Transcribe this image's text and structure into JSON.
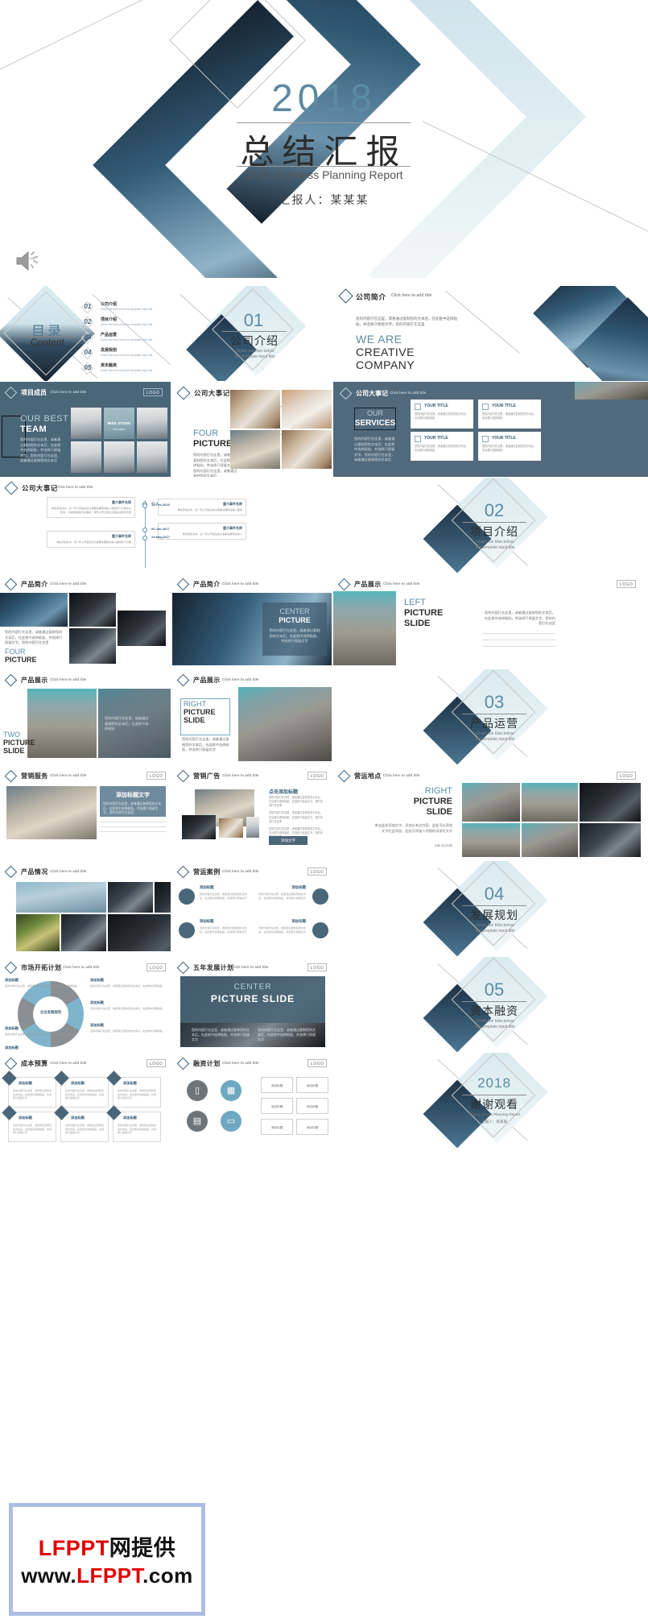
{
  "document": {
    "type": "powerpoint-template-preview",
    "watermark": {
      "line1_red": "LFPPT",
      "line1_black": "网提供",
      "line2_prefix": "www.",
      "line2_red": "LFPPT",
      "line2_suffix": ".com"
    },
    "accent_color": "#4a6679",
    "accent_light": "#bcd6de",
    "title_blue": "#5b8ba3"
  },
  "cover": {
    "year": "2018",
    "title_cn": "总结汇报",
    "subtitle_en": "2018 Business Planning Report",
    "presenter": "汇报人：某某某",
    "audio_icon": "speaker-icon"
  },
  "toc": {
    "title_cn": "目录",
    "title_en": "Content",
    "items": [
      {
        "num": "01",
        "label": "公司介绍",
        "desc": "Under the blue below the template input title"
      },
      {
        "num": "02",
        "label": "项目介绍",
        "desc": "Under the blue below the template input title"
      },
      {
        "num": "03",
        "label": "产品运营",
        "desc": "Under the blue below the template input title"
      },
      {
        "num": "04",
        "label": "发展规划",
        "desc": "Under the blue below the template input title"
      },
      {
        "num": "05",
        "label": "资本融资",
        "desc": "Under the blue below the template input title"
      }
    ]
  },
  "sections": [
    {
      "num": "01",
      "title": "公司介绍",
      "sub1": "Under the blue below",
      "sub2": "the template input title"
    },
    {
      "num": "02",
      "title": "项目介绍",
      "sub1": "Under the blue below",
      "sub2": "the template input title"
    },
    {
      "num": "03",
      "title": "产品运营",
      "sub1": "Under the blue below",
      "sub2": "the template input title"
    },
    {
      "num": "04",
      "title": "发展规划",
      "sub1": "Under the blue below",
      "sub2": "the template input title"
    },
    {
      "num": "05",
      "title": "资本融资",
      "sub1": "Under the blue below",
      "sub2": "the template input title"
    }
  ],
  "closing": {
    "year": "2018",
    "title_cn": "谢谢观看",
    "subtitle_en": "2018 Business Planning Report",
    "presenter": "汇报人：某某某"
  },
  "slide_headers": {
    "company_profile": "公司简介",
    "team_members": "项目成员",
    "company_events": "公司大事记",
    "product_intro": "产品简介",
    "product_detail": "产品展示",
    "marketing_plan": "营销服务",
    "marketing_ad": "营销广告",
    "operation_site": "营运地点",
    "product_situation": "产品情况",
    "business_case": "营运案例",
    "market_plan": "市场开拓计划",
    "five_year_plan": "五年发展计划",
    "cost_budget": "成本预算",
    "finance_plan": "融资计划",
    "click_hint": "Click here to add title"
  },
  "logo_label": "LOGO",
  "slides": {
    "company_profile": {
      "body": "您的内容打在这里，或者通过复制您的文本后，在此框中选择粘贴，并选择只保留文字。您的内容打在这里",
      "headline1": "WE ARE",
      "headline2": "CREATIVE",
      "headline3": "COMPANY"
    },
    "team": {
      "headline1": "OUR BEST",
      "headline2": "TEAM",
      "body": "您的内容打在这里，或者通过复制您的文本后，在此框中选择粘贴，并选择只保留文字。您的内容打在这里，或者通过复制您的文本后",
      "highlight_name": "MIKE STONG",
      "highlight_role": "Manager"
    },
    "four_picture": {
      "headline1": "FOUR",
      "headline2": "PICTURE SLIDE",
      "body": "您的内容打在这里，或者通过复制您的文本后，在此框中选择粘贴，并选择只保留文字。您的内容打在这里，或者通过复制您的文本后"
    },
    "our_services": {
      "headline1": "OUR",
      "headline2": "SERVICES",
      "body": "您的内容打在这里，或者通过复制您的文本后，在此框中选择粘贴，并选择只保留文字。您的内容打在这里，或者通过复制您的文本后",
      "cards": [
        {
          "title": "YOUR TITLE",
          "body": "您的内容打在这里，或者通过复制您的文本后，在此框中选择粘贴"
        },
        {
          "title": "YOUR TITLE",
          "body": "您的内容打在这里，或者通过复制您的文本后，在此框中选择粘贴"
        },
        {
          "title": "YOUR TITLE",
          "body": "您的内容打在这里，或者通过复制您的文本后，在此框中选择粘贴"
        },
        {
          "title": "YOUR TITLE",
          "body": "您的内容打在这里，或者通过复制您的文本后，在此框中选择粘贴"
        }
      ]
    },
    "timeline": {
      "events": [
        {
          "date": "27 Jan,2014",
          "title": "重大事件名称",
          "body": "单击添加文本，这一年公司发生的大事都在展现在输入图案的下方框中心区域，只有重新组织过0程序，很专公司之的在大做左边的年手者"
        },
        {
          "date": "18 Feb,2015",
          "title": "重大事件名称",
          "body": "单击添加文本，这一年公司发生的大事都在展现在输入图案"
        },
        {
          "date": "06 Jan,2017",
          "title": "重大事件名称",
          "body": "单击添加文本，这一年公司发生的大事都在展现在输入"
        },
        {
          "date": "14 May,2017",
          "title": "重大事件名称",
          "body": "单击添加文本，这一年公司发生的大事都在展现在输入图案的下方框"
        }
      ]
    },
    "product_four": {
      "headline1": "FOUR",
      "headline2": "PICTURE",
      "headline3": "SLIDE",
      "body": "您的内容打在这里，或者通过复制您的文本后，在此框中选择粘贴，并选择只保留文字。您的内容打在这里"
    },
    "center_picture": {
      "headline1": "CENTER",
      "headline2": "PICTURE",
      "body": "您的内容打在这里，或者通过复制您的文本后，在此框中选择粘贴，并选择只保留文字"
    },
    "left_picture": {
      "headline1": "LEFT",
      "headline2": "PICTURE",
      "headline3": "SLIDE",
      "body": "您的内容打在这里，或者通过复制您的文本后，在此框中选择粘贴，并选择只保留文字。您的内容打在这里"
    },
    "two_picture": {
      "headline1": "TWO",
      "headline2": "PICTURE",
      "headline3": "SLIDE",
      "body": "您的内容打在这里，或者通过复制您的文本后，在此框中选择粘贴"
    },
    "right_picture": {
      "headline1": "RIGHT",
      "headline2": "PICTURE",
      "headline3": "SLIDE",
      "body": "您的内容打在这里，或者通过复制您的文本后，在此框中选择粘贴，并选择只保留文字"
    },
    "right_picture2": {
      "headline1": "RIGHT",
      "headline2": "PICTURE",
      "headline3": "SLIDE",
      "body": "单击此处添加文字，添加从本文内容，此处可以添加文字在此添加，此处可添加入并细的添加可文字",
      "caption": "标题 添加标题"
    },
    "marketing": {
      "title": "添加标题文字",
      "body": "您的内容打在这里，或者通过复制您的文本后，在此框中选择粘贴，并选择只保留文字。您的内容打在这里"
    },
    "marketing_ad": {
      "title": "点击添加标题",
      "paras": [
        "您的内容打在这里，或者通过复制您的文本后，在此框中选择粘贴，并选择只保留文字。您的内容打在这里",
        "您的内容打在这里，或者通过复制您的文本后，在此框中选择粘贴，并选择只保留文字。您的内容打在这里",
        "您的内容打在这里，或者通过复制您的文本后，在此框中选择粘贴，并选择只保留文字。您的内容打在这里"
      ],
      "button": "添加文字"
    },
    "business_case": {
      "items": [
        {
          "title": "添加标题",
          "body": "您的内容打在这里，或者通过复制您的文本后，在此框中选择粘贴，并选择只保留文字",
          "icon": "share-icon"
        },
        {
          "title": "添加标题",
          "body": "您的内容打在这里，或者通过复制您的文本后，在此框中选择粘贴，并选择只保留文字",
          "icon": "search-icon"
        },
        {
          "title": "添加标题",
          "body": "您的内容打在这里，或者通过复制您的文本后，在此框中选择粘贴，并选择只保留文字",
          "icon": "infinity-icon"
        },
        {
          "title": "添加标题",
          "body": "您的内容打在这里，或者通过复制您的文本后，在此框中选择粘贴，并选择只保留文字",
          "icon": "home-icon"
        }
      ]
    },
    "market_plan": {
      "center_label": "企业发展规划",
      "items": [
        {
          "title": "添加标题",
          "body": "您的内容打在这里，或者通过复制您的文本后，在此框中选择粘贴"
        },
        {
          "title": "添加标题",
          "body": "您的内容打在这里，或者通过复制您的文本后，在此框中选择粘贴"
        },
        {
          "title": "添加标题",
          "body": "您的内容打在这里，或者通过复制您的文本后，在此框中选择粘贴"
        },
        {
          "title": "添加标题",
          "body": "您的内容打在这里，或者通过复制您的文本后，在此框中选择粘贴"
        },
        {
          "title": "添加标题",
          "body": "您的内容打在这里，或者通过复制您的文本后，在此框中选择粘贴"
        },
        {
          "title": "添加标题",
          "body": "您的内容打在这里，或者通过复制您的文本后，在此框中选择粘贴"
        }
      ]
    },
    "five_year": {
      "headline1": "CENTER",
      "headline2": "PICTURE SLIDE",
      "left_body": "您的内容打在这里，或者通过复制您的文本后，在此框中选择粘贴，并选择只保留文字",
      "right_body": "您的内容打在这里，或者通过复制您的文本后，在此框中选择粘贴，并选择只保留文字"
    },
    "cost_budget": {
      "cards": [
        {
          "title": "添加标题",
          "body": "您的内容打在这里，或者通过复制您的文本后，在此框中选择粘贴，并选择只保留文字"
        },
        {
          "title": "添加标题",
          "body": "您的内容打在这里，或者通过复制您的文本后，在此框中选择粘贴，并选择只保留文字"
        },
        {
          "title": "添加标题",
          "body": "您的内容打在这里，或者通过复制您的文本后，在此框中选择粘贴，并选择只保留文字"
        },
        {
          "title": "添加标题",
          "body": "您的内容打在这里，或者通过复制您的文本后，在此框中选择粘贴，并选择只保留文字"
        },
        {
          "title": "添加标题",
          "body": "您的内容打在这里，或者通过复制您的文本后，在此框中选择粘贴，并选择只保留文字"
        },
        {
          "title": "添加标题",
          "body": "您的内容打在这里，或者通过复制您的文本后，在此框中选择粘贴，并选择只保留文字"
        }
      ]
    },
    "finance_plan": {
      "icons": [
        "mobile-icon",
        "chart-icon",
        "tablet-icon",
        "monitor-icon"
      ],
      "labels": [
        "添加标题",
        "添加标题",
        "添加标题",
        "添加标题",
        "添加标题",
        "添加标题"
      ]
    }
  }
}
